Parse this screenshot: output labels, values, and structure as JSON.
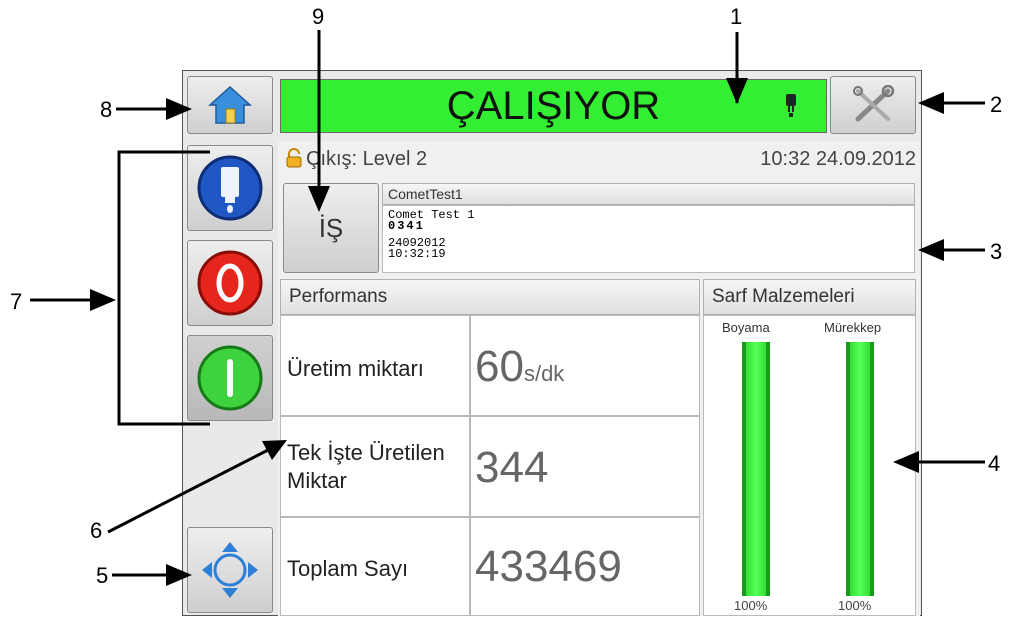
{
  "header": {
    "status_text": "ÇALIŞIYOR",
    "status_color": "#33ee33",
    "home_icon": "home-icon",
    "tools_icon": "tools-icon"
  },
  "info_bar": {
    "login_label": "Çıkış: Level 2",
    "datetime": "10:32 24.09.2012"
  },
  "job": {
    "button_label": "İŞ",
    "name": "CometTest1",
    "preview_lines": [
      "Comet Test 1",
      "0341",
      "24092012",
      "10:32:19"
    ]
  },
  "performance": {
    "title": "Performans",
    "rows": [
      {
        "label": "Üretim miktarı",
        "value": "60",
        "unit": "s/dk"
      },
      {
        "label": "Tek İşte Üretilen Miktar",
        "value": "344",
        "unit": ""
      },
      {
        "label": "Toplam Sayı",
        "value": "433469",
        "unit": ""
      }
    ]
  },
  "consumables": {
    "title": "Sarf Malzemeleri",
    "items": [
      {
        "label": "Boyama",
        "level_text": "100%",
        "level": 1.0
      },
      {
        "label": "Mürekkep",
        "level_text": "100%",
        "level": 1.0
      }
    ]
  },
  "sidebar": {
    "buttons": [
      "ink-drop-icon",
      "stop-icon",
      "start-icon"
    ],
    "nav_icon": "navigation-arrows-icon"
  },
  "callouts": [
    "1",
    "2",
    "3",
    "4",
    "5",
    "6",
    "7",
    "8",
    "9"
  ]
}
